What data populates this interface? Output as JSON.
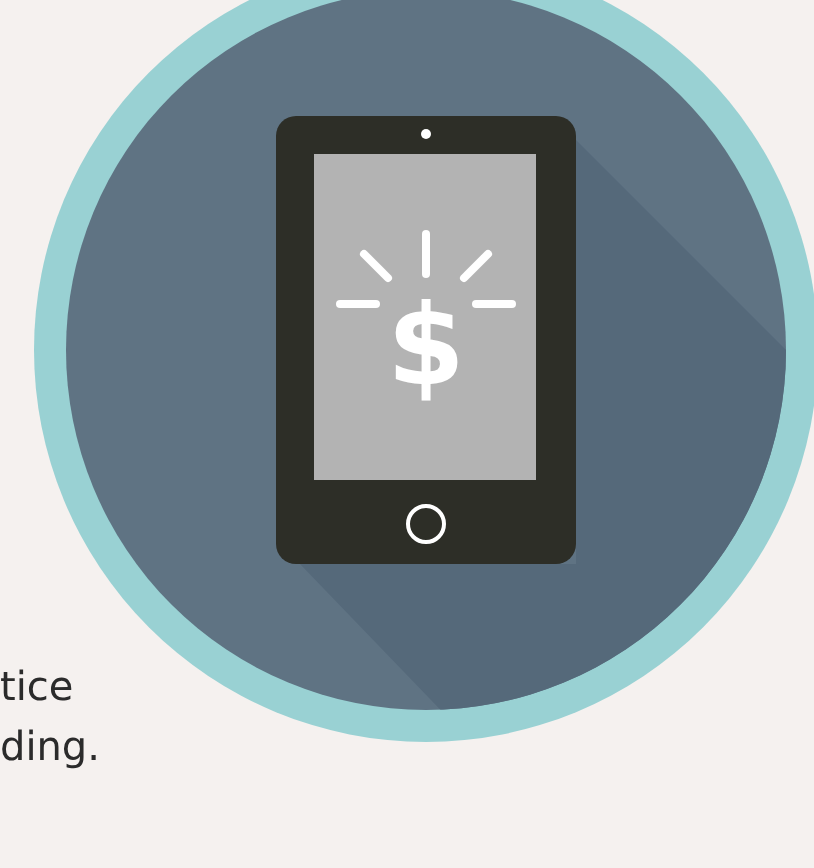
{
  "illustration": {
    "symbol": "$"
  },
  "text_lines": [
    "tice",
    "ding."
  ]
}
